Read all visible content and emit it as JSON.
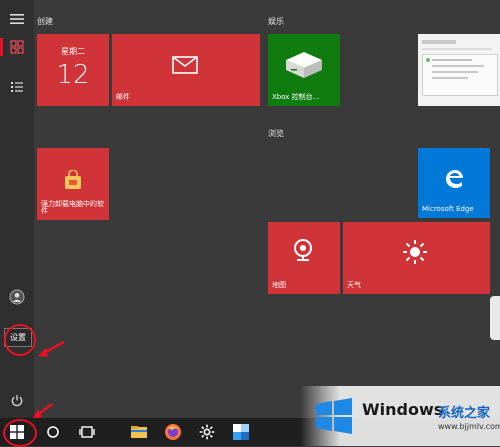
{
  "groups": {
    "create": "创建",
    "entertainment": "娱乐",
    "browse": "浏览"
  },
  "tiles": {
    "calendar": {
      "weekday": "星期二",
      "day": "12"
    },
    "mail": {
      "label": "邮件"
    },
    "xbox": {
      "label": "Xbox 控制台..."
    },
    "software": {
      "label": "强力卸载电脑中的软件"
    },
    "edge": {
      "label": "Microsoft Edge"
    },
    "maps": {
      "label": "地图"
    },
    "weather": {
      "label": "天气"
    }
  },
  "tooltip": {
    "text": "设置"
  },
  "watermark": {
    "brand": "Windows",
    "site": "系统之家",
    "url": "www.bjjmlv.com"
  },
  "colors": {
    "tile_red": "#d13438",
    "xbox_green": "#107c10",
    "edge_blue": "#0078d7",
    "annotation_red": "#e81123"
  }
}
